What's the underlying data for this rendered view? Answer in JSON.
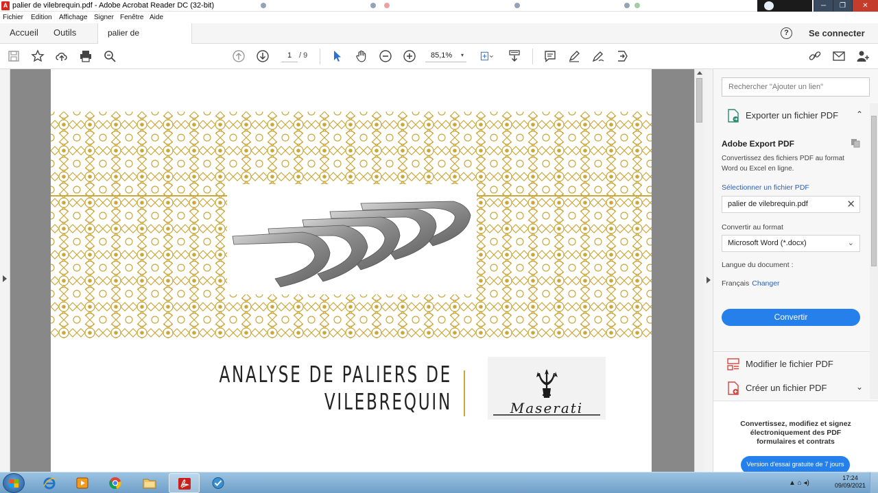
{
  "window": {
    "title": "palier de vilebrequin.pdf - Adobe Acrobat Reader DC (32-bit)",
    "minimize": "─",
    "maximize": "❐",
    "close": "✕"
  },
  "menu": [
    "Fichier",
    "Edition",
    "Affichage",
    "Signer",
    "Fenêtre",
    "Aide"
  ],
  "tabs": {
    "home": "Accueil",
    "tools": "Outils",
    "document": "palier de vilebrequin...",
    "close": "×"
  },
  "header": {
    "help": "?",
    "signin": "Se connecter"
  },
  "toolbar": {
    "page_current": "1",
    "page_total": "/ 9",
    "zoom": "85,1%",
    "zoom_caret": "▾"
  },
  "document": {
    "title_line1": "ANALYSE DE PALIERS DE",
    "title_line2": "VILEBREQUIN",
    "logo_text": "Maserati",
    "accent_color": "#c9a73a"
  },
  "right_pane": {
    "search_placeholder": "Rechercher \"Ajouter un lien\"",
    "export_tool_label": "Exporter un fichier PDF",
    "export_tool_chevron": "⌃",
    "card_title": "Adobe Export PDF",
    "card_desc": "Convertissez des fichiers PDF au format Word ou Excel en ligne.",
    "select_file_link": "Sélectionner un fichier PDF",
    "selected_file": "palier de vilebrequin.pdf",
    "remove_file": "✕",
    "convert_to_label": "Convertir au format",
    "convert_to_value": "Microsoft Word (*.docx)",
    "select_chevron": "⌄",
    "language_label": "Langue du document :",
    "language_value": "Français",
    "language_change": "Changer",
    "convert_button": "Convertir",
    "edit_pdf": "Modifier le fichier PDF",
    "create_pdf": "Créer un fichier PDF",
    "create_chevron": "⌄",
    "promo_text": "Convertissez, modifiez et signez électroniquement des PDF formulaires et contrats",
    "promo_button": "Version d'essai gratuite de 7 jours"
  },
  "taskbar": {
    "time": "17:24",
    "date": "09/09/2021",
    "tray_icons": "▲ ⌂ ◂)"
  }
}
